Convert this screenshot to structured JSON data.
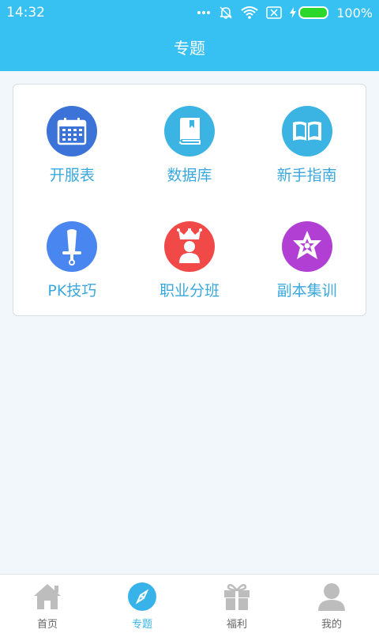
{
  "status_bar": {
    "time": "14:32",
    "battery_percent": "100%",
    "icons": [
      "more-dots-icon",
      "notification-off-icon",
      "wifi-icon",
      "sim-off-icon",
      "charging-icon",
      "battery-icon"
    ]
  },
  "header": {
    "title": "专题"
  },
  "topics": [
    {
      "label": "开服表",
      "icon": "calendar-icon",
      "color": "#3b73d9"
    },
    {
      "label": "数据库",
      "icon": "book-icon",
      "color": "#3cb4e3"
    },
    {
      "label": "新手指南",
      "icon": "open-book-icon",
      "color": "#3cb4e3"
    },
    {
      "label": "PK技巧",
      "icon": "sword-icon",
      "color": "#4a86f0"
    },
    {
      "label": "职业分班",
      "icon": "king-icon",
      "color": "#f14848"
    },
    {
      "label": "副本集训",
      "icon": "star-badge-icon",
      "color": "#b13fd3"
    }
  ],
  "bottom_nav": [
    {
      "label": "首页",
      "icon": "home-icon",
      "active": false
    },
    {
      "label": "专题",
      "icon": "compass-icon",
      "active": true
    },
    {
      "label": "福利",
      "icon": "gift-icon",
      "active": false
    },
    {
      "label": "我的",
      "icon": "user-icon",
      "active": false
    }
  ],
  "colors": {
    "accent": "#37c0f2",
    "background": "#f2f7fb",
    "label": "#3aa8de"
  }
}
